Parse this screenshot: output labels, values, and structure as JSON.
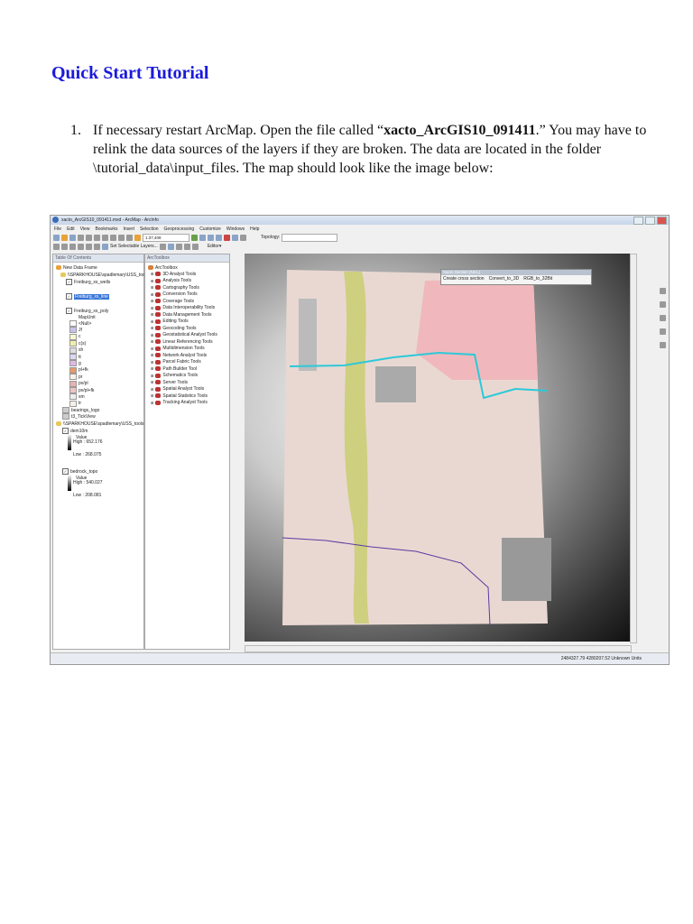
{
  "doc": {
    "title": "Quick Start Tutorial",
    "step_number": "1.",
    "step_text_1": "If necessary restart ArcMap.  Open the file called “",
    "step_bold": "xacto_ArcGIS10_091411",
    "step_text_2": ".”  You may have to relink  the data sources of the layers if they are broken.  The data are located in the folder \\tutorial_data\\input_files.  The map should look like the image below:"
  },
  "app": {
    "window_title": "xacto_ArcGIS10_091411.mxd - ArcMap - ArcInfo",
    "menu": [
      "File",
      "Edit",
      "View",
      "Bookmarks",
      "Insert",
      "Selection",
      "Geoprocessing",
      "Customize",
      "Windows",
      "Help"
    ],
    "scale": "1:37,408",
    "topology_label": "Topology:",
    "set_selectable": "Set Selectable Layers...",
    "editor": "Editor▾",
    "toc": {
      "title": "Table Of Contents",
      "frame": "New Data Frame",
      "folder1": "\\\\SPARKHOUSE\\spadlemary\\USS_tools",
      "layer1": "Freiburg_xs_wells",
      "layer2": "Freiburg_xs_line",
      "layer3": "Freiburg_xs_poly",
      "mapunit": "MapUnit",
      "units": [
        {
          "label": "<Null>",
          "color": "#ffffff"
        },
        {
          "label": "Jf",
          "color": "#c9c3ea"
        },
        {
          "label": "c",
          "color": "#f8f8d0"
        },
        {
          "label": "c(s)",
          "color": "#f0f0a8"
        },
        {
          "label": "sh",
          "color": "#dddddd"
        },
        {
          "label": "tt",
          "color": "#dcd8f4"
        },
        {
          "label": "g",
          "color": "#e0b8e8"
        },
        {
          "label": "pl+fk",
          "color": "#e89a6a"
        },
        {
          "label": "pr",
          "color": "#fbf1ea"
        },
        {
          "label": "pv/pl",
          "color": "#e8b2b2"
        },
        {
          "label": "pv/pl+fk",
          "color": "#f0c4c4"
        },
        {
          "label": "sm",
          "color": "#eeeeee"
        },
        {
          "label": "tr",
          "color": "#f6f0ea"
        }
      ],
      "layer4": "bearings_logo",
      "layer5": "t3_TickView",
      "folder2": "\\\\SPARKHOUSE\\spadlemary\\USS_tools",
      "raster1": "dem10m",
      "raster2": "bedrock_topo",
      "value_label": "Value",
      "r1_high": "High : 652.176",
      "r1_low": "Low : 268.075",
      "r2_high": "High : 540.027",
      "r2_low": "Low : 208.081"
    },
    "toolbox": {
      "title": "ArcToolbox",
      "root": "ArcToolbox",
      "tools": [
        "3D Analyst Tools",
        "Analysis Tools",
        "Cartography Tools",
        "Conversion Tools",
        "Coverage Tools",
        "Data Interoperability Tools",
        "Data Management Tools",
        "Editing Tools",
        "Geocoding Tools",
        "Geostatistical Analyst Tools",
        "Linear Referencing Tools",
        "Multidimension Tools",
        "Network Analyst Tools",
        "Parcel Fabric Tools",
        "Path Builder Tool",
        "Schematics Tools",
        "Server Tools",
        "Spatial Analyst Tools",
        "Spatial Statistics Tools",
        "Tracking Analyst Tools"
      ]
    },
    "dialog": {
      "title": "Xacto Section (NCL)",
      "create": "Create cross section",
      "convert": "Convert_to_3D",
      "rgb": "RGB_to_32Bit"
    },
    "status": "2484327.79  4280207.52 Unknown Units"
  }
}
